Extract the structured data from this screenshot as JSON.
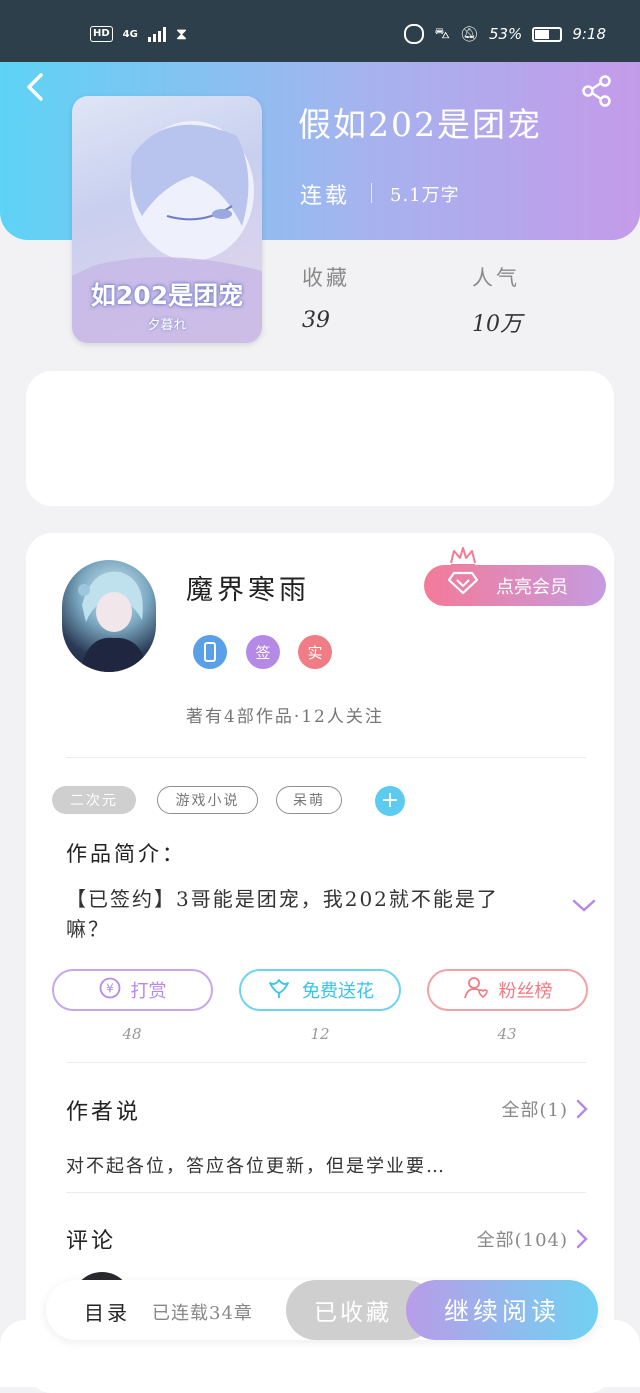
{
  "status_bar": {
    "hd": "HD",
    "network": "4G",
    "battery": "53%",
    "time": "9:18"
  },
  "book": {
    "title": "假如202是团宠",
    "status": "连载",
    "word_count": "5.1万字",
    "cover_title": "如202是团宠",
    "cover_author": "夕暮れ",
    "stats": {
      "favorites_label": "收藏",
      "favorites_value": "39",
      "popularity_label": "人气",
      "popularity_value": "10万"
    }
  },
  "author": {
    "name": "魔界寒雨",
    "vip_button": "点亮会员",
    "badges": [
      {
        "icon": "phone-badge-icon",
        "label": "",
        "color": "#5aa0e8"
      },
      {
        "icon": "signed-badge-icon",
        "label": "签",
        "color": "#b58ae6"
      },
      {
        "icon": "verified-badge-icon",
        "label": "实",
        "color": "#f07c84"
      }
    ],
    "meta": "著有4部作品·12人关注"
  },
  "tags": [
    {
      "label": "二次元",
      "style": "filled"
    },
    {
      "label": "游戏小说",
      "style": "outline"
    },
    {
      "label": "呆萌",
      "style": "outline"
    }
  ],
  "intro": {
    "title": "作品简介：",
    "text": "【已签约】3哥能是团宠，我202就不能是了嘛？"
  },
  "actions": [
    {
      "label": "打赏",
      "count": "48",
      "icon": "yen-coin-icon",
      "color": "#b58ae6"
    },
    {
      "label": "免费送花",
      "count": "12",
      "icon": "flower-icon",
      "color": "#39c3ea"
    },
    {
      "label": "粉丝榜",
      "count": "43",
      "icon": "fans-user-icon",
      "color": "#f07c84"
    }
  ],
  "author_says": {
    "title": "作者说",
    "more": "全部(1)",
    "text": "对不起各位，答应各位更新，但是学业要…"
  },
  "comments": {
    "title": "评论",
    "more": "全部(104)"
  },
  "bottom_bar": {
    "toc": "目录",
    "serial": "已连载34章",
    "favorited": "已收藏",
    "continue": "继续阅读"
  },
  "colors": {
    "header_gradient_start": "#5dd3f5",
    "header_gradient_end": "#c49bea",
    "vip_gradient_start": "#f47a98",
    "vip_gradient_end": "#c59be0",
    "accent_purple": "#b58ae6",
    "accent_blue": "#39c3ea",
    "accent_red": "#f07c84"
  }
}
